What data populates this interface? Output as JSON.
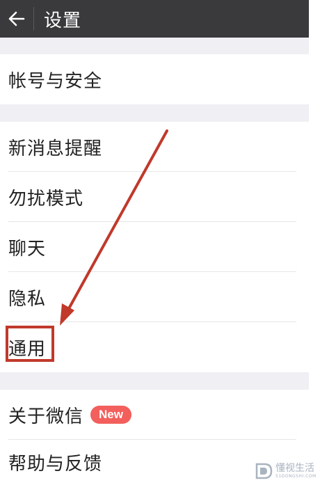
{
  "header": {
    "title": "设置",
    "back_icon": "arrow-left-icon"
  },
  "groups": [
    {
      "items": [
        {
          "label": "帐号与安全"
        }
      ]
    },
    {
      "items": [
        {
          "label": "新消息提醒"
        },
        {
          "label": "勿扰模式"
        },
        {
          "label": "聊天"
        },
        {
          "label": "隐私"
        },
        {
          "label": "通用"
        }
      ]
    },
    {
      "items": [
        {
          "label": "关于微信",
          "badge": "New"
        },
        {
          "label": "帮助与反馈"
        }
      ]
    }
  ],
  "annotation": {
    "highlight_color": "#c0392b"
  },
  "watermark": {
    "text": "懂视生活",
    "sub": "51DONGSHI.COM"
  },
  "colors": {
    "header_bg": "#3a3a3c",
    "section_gap": "#efeff4",
    "badge_bg": "#f25f5c"
  }
}
